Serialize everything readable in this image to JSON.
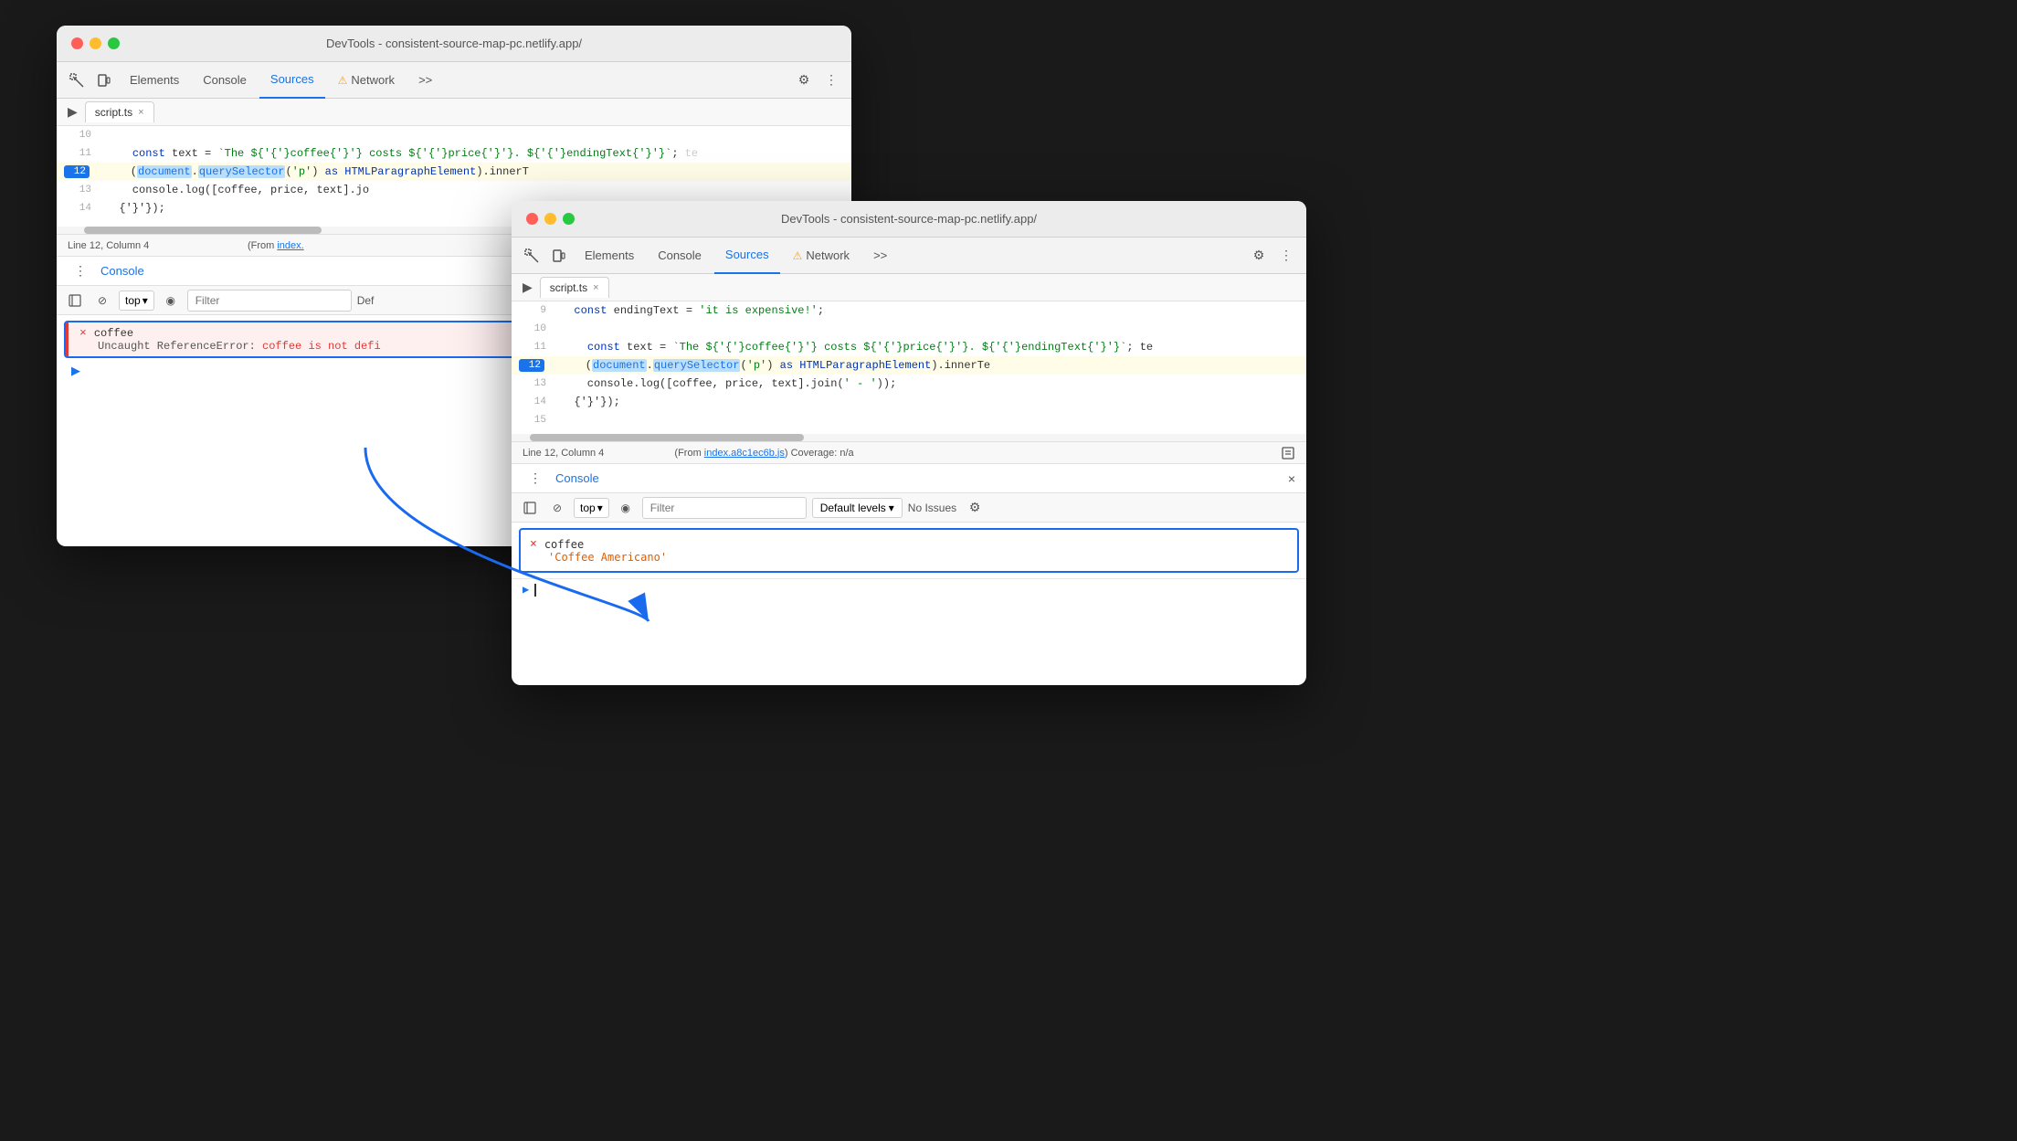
{
  "window1": {
    "title": "DevTools - consistent-source-map-pc.netlify.app/",
    "tabs": [
      "Elements",
      "Console",
      "Sources",
      "Network",
      ">>"
    ],
    "active_tab": "Sources",
    "file_tab": "script.ts",
    "code_lines": [
      {
        "num": "10",
        "content_html": ""
      },
      {
        "num": "11",
        "content_html": "    <span class='kw'>const</span> text = <span class='str'>`The ${coffee} costs ${price}. ${endingText}`</span>;  <span style='color:#aaa'>te</span>"
      },
      {
        "num": "12",
        "content_html": "    (<span class='hl-blue hl-doc'>document</span>.<span class='hl-blue hl-doc'>querySelector</span>(<span class='str'>'p'</span>) <span class='kw'>as</span> <span class='tp'>HTMLParagraphElement</span>).innerT",
        "active": true
      },
      {
        "num": "13",
        "content_html": "    console.log([coffee, price, text].jo"
      },
      {
        "num": "14",
        "content_html": "  });"
      }
    ],
    "status": {
      "line_col": "Line 12, Column 4",
      "from_text": "(From ",
      "from_link": "index.",
      "from_rest": ""
    },
    "console": {
      "title": "Console",
      "filter_placeholder": "Filter",
      "default_levels": "Def",
      "top_label": "top",
      "error_msg": {
        "error_x": "×",
        "label": "coffee",
        "error_text": "Uncaught ReferenceError: ",
        "error_detail": "coffee is not defi"
      }
    }
  },
  "window2": {
    "title": "DevTools - consistent-source-map-pc.netlify.app/",
    "tabs": [
      "Elements",
      "Console",
      "Sources",
      "Network",
      ">>"
    ],
    "active_tab": "Sources",
    "file_tab": "script.ts",
    "code_lines": [
      {
        "num": "9",
        "content_html": "  <span class='kw'>const</span> endingText = <span class='str'>'it is expensive!'</span>;"
      },
      {
        "num": "10",
        "content_html": ""
      },
      {
        "num": "11",
        "content_html": "    <span class='kw'>const</span> text = <span class='str'>`The ${coffee} costs ${price}. ${endingText}`</span>;  te"
      },
      {
        "num": "12",
        "content_html": "    (<span class='hl-blue hl-doc'>document</span>.<span class='hl-blue hl-doc'>querySelector</span>(<span class='str'>'p'</span>) <span class='kw'>as</span> <span class='tp'>HTMLParagraphElement</span>).innerTe",
        "active": true
      },
      {
        "num": "13",
        "content_html": "    console.log([coffee, price, text].join(<span class='str'>' - '</span>));"
      },
      {
        "num": "14",
        "content_html": "  });"
      },
      {
        "num": "15",
        "content_html": ""
      }
    ],
    "status": {
      "line_col": "Line 12, Column 4",
      "from_text": "(From ",
      "from_link": "index.a8c1ec6b.js",
      "coverage": ") Coverage: n/a"
    },
    "console": {
      "title": "Console",
      "filter_placeholder": "Filter",
      "default_levels": "Default levels",
      "no_issues": "No Issues",
      "top_label": "top",
      "error_msg": {
        "error_x": "×",
        "label": "coffee",
        "output_str": "'Coffee Americano'"
      }
    }
  },
  "icons": {
    "inspect": "⬚",
    "device": "⬜",
    "settings": "⚙",
    "more": "⋮",
    "sidebar": "◧",
    "clear": "⊘",
    "eye": "◉",
    "caret": "▾",
    "close": "×",
    "expand": "▶",
    "collapse": "▶"
  }
}
